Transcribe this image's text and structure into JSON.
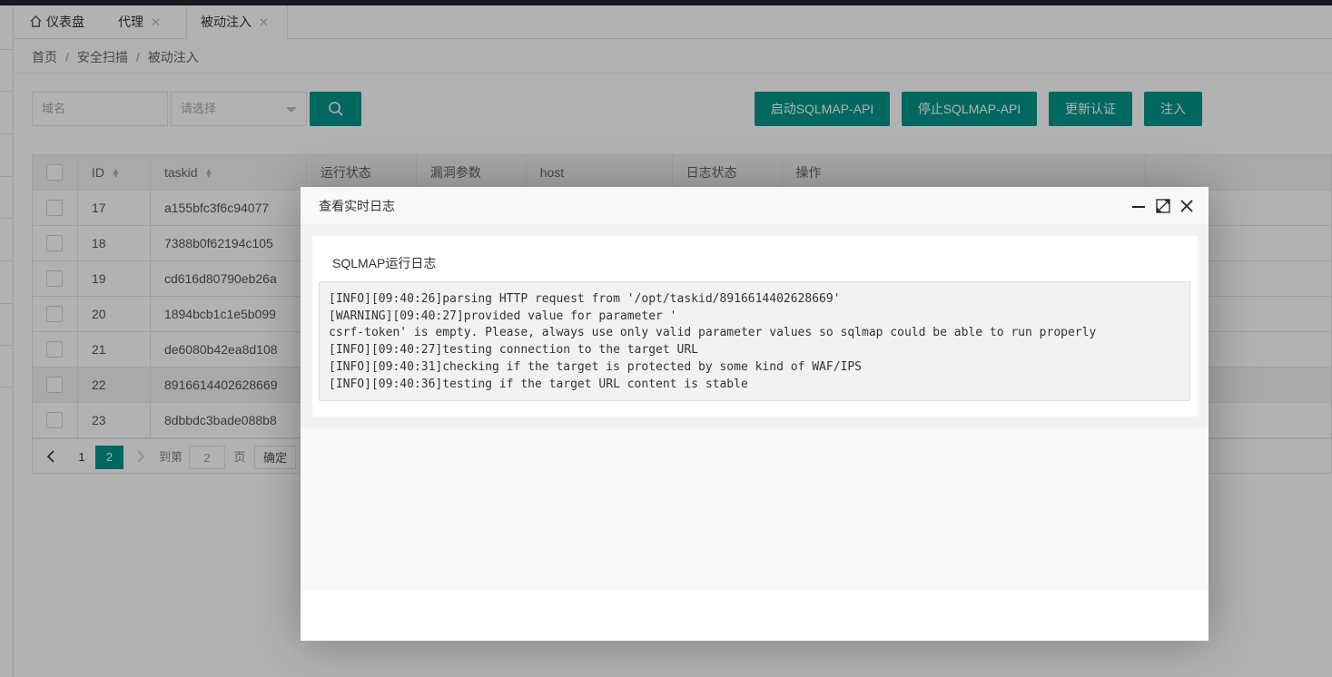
{
  "tabs": [
    {
      "label": "仪表盘",
      "icon": "home-icon"
    },
    {
      "label": "代理",
      "closable": true
    },
    {
      "label": "被动注入",
      "closable": true,
      "active": true
    }
  ],
  "breadcrumb": [
    "首页",
    "安全扫描",
    "被动注入"
  ],
  "breadcrumb_separator": "/",
  "filters": {
    "domain_placeholder": "域名",
    "select_placeholder": "请选择"
  },
  "actions": {
    "start": "启动SQLMAP-API",
    "stop": "停止SQLMAP-API",
    "update_auth": "更新认证",
    "inject": "注入"
  },
  "table": {
    "headers": [
      "ID",
      "taskid",
      "运行状态",
      "漏洞参数",
      "host",
      "日志状态",
      "操作"
    ],
    "rows": [
      {
        "id": "17",
        "taskid": "a155bfc3f6c94077"
      },
      {
        "id": "18",
        "taskid": "7388b0f62194c105"
      },
      {
        "id": "19",
        "taskid": "cd616d80790eb26a"
      },
      {
        "id": "20",
        "taskid": "1894bcb1c1e5b099"
      },
      {
        "id": "21",
        "taskid": "de6080b42ea8d108"
      },
      {
        "id": "22",
        "taskid": "8916614402628669"
      },
      {
        "id": "23",
        "taskid": "8dbbdc3bade088b8"
      }
    ]
  },
  "pager": {
    "pages": [
      "1",
      "2"
    ],
    "current": "2",
    "goto_label": "到第",
    "goto_value": "2",
    "page_label": "页",
    "confirm": "确定"
  },
  "dialog": {
    "title": "查看实时日志",
    "section_title": "SQLMAP运行日志",
    "log_lines": [
      "[INFO][09:40:26]parsing HTTP request from '/opt/taskid/8916614402628669'",
      "[WARNING][09:40:27]provided value for parameter '",
      "csrf-token' is empty. Please, always use only valid parameter values so sqlmap could be able to run properly",
      "[INFO][09:40:27]testing connection to the target URL",
      "[INFO][09:40:31]checking if the target is protected by some kind of WAF/IPS",
      "[INFO][09:40:36]testing if the target URL content is stable"
    ]
  },
  "colors": {
    "primary": "#009688",
    "topbar": "#23262e"
  }
}
